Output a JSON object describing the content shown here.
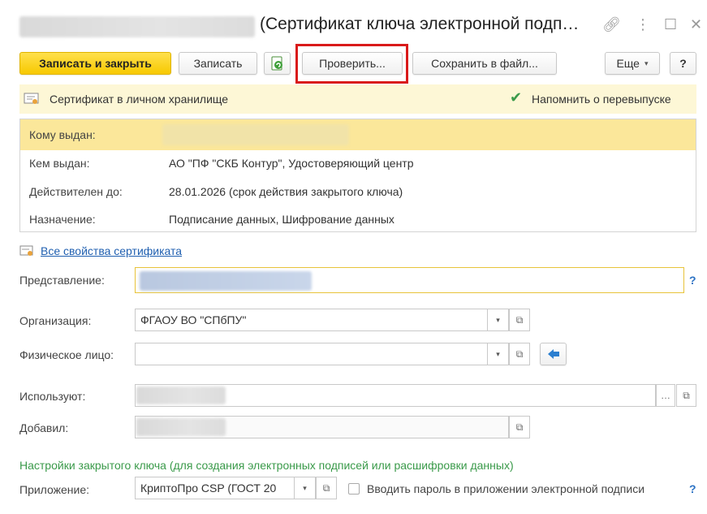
{
  "window": {
    "title": "(Сертификат ключа электронной подп…",
    "link_icon": "link-icon",
    "menu_icon": "more-vertical-icon",
    "maximize_icon": "maximize-icon",
    "close_icon": "close-icon"
  },
  "toolbar": {
    "save_close_label": "Записать и закрыть",
    "save_label": "Записать",
    "check_label": "Проверить...",
    "save_to_file_label": "Сохранить в файл...",
    "more_label": "Еще",
    "help_label": "?"
  },
  "status": {
    "storage_text": "Сертификат в личном хранилище",
    "remind_label": "Напомнить о перевыпуске",
    "remind_checked": "✔"
  },
  "certificate": {
    "issued_to_label": "Кому выдан:",
    "issued_by_label": "Кем выдан:",
    "issued_by_value": "АО \"ПФ \"СКБ Контур\", Удостоверяющий центр",
    "valid_until_label": "Действителен до:",
    "valid_until_value": "28.01.2026 (срок действия закрытого ключа)",
    "purpose_label": "Назначение:",
    "purpose_value": "Подписание данных, Шифрование данных"
  },
  "all_properties_link": "Все свойства сертификата",
  "form": {
    "presentation_label": "Представление:",
    "organization_label": "Организация:",
    "organization_value": "ФГАОУ ВО \"СПбПУ\"",
    "person_label": "Физическое лицо:",
    "users_label": "Используют:",
    "added_by_label": "Добавил:"
  },
  "private_key": {
    "section_title": "Настройки закрытого ключа (для создания электронных подписей или расшифровки данных)",
    "app_label": "Приложение:",
    "app_value": "КриптоПро CSP (ГОСТ 20",
    "password_label": "Вводить пароль в приложении электронной подписи"
  },
  "colors": {
    "primary_button": "#f7c900",
    "highlight_row": "#fbe79a",
    "link": "#1f5fb0",
    "section_title": "#3a9a4a",
    "annotation_red": "#d91a1a"
  }
}
